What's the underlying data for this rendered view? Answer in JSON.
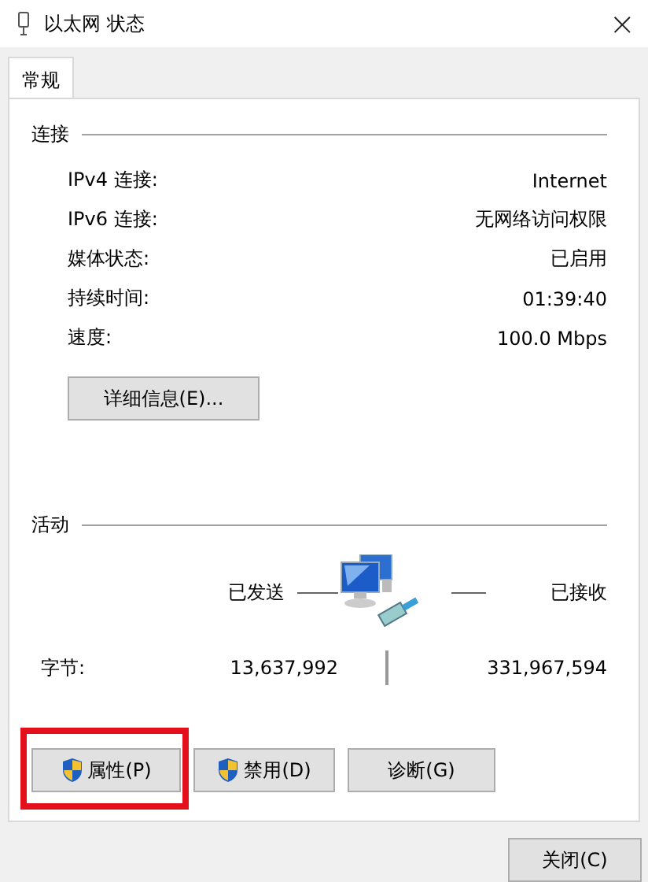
{
  "window": {
    "title": "以太网 状态",
    "close": "×"
  },
  "tabs": [
    {
      "label": "常规",
      "selected": true
    }
  ],
  "connection": {
    "heading": "连接",
    "rows": [
      {
        "label": "IPv4 连接:",
        "value": "Internet"
      },
      {
        "label": "IPv6 连接:",
        "value": "无网络访问权限"
      },
      {
        "label": "媒体状态:",
        "value": "已启用"
      },
      {
        "label": "持续时间:",
        "value": "01:39:40"
      },
      {
        "label": "速度:",
        "value": "100.0 Mbps"
      }
    ],
    "details_button": "详细信息(E)..."
  },
  "activity": {
    "heading": "活动",
    "sent_label": "已发送",
    "received_label": "已接收",
    "bytes_label": "字节:",
    "sent": "13,637,992",
    "received": "331,967,594"
  },
  "buttons": [
    {
      "label": "属性(P)",
      "shield": true,
      "highlighted": true
    },
    {
      "label": "禁用(D)",
      "shield": true,
      "highlighted": false
    },
    {
      "label": "诊断(G)",
      "shield": false,
      "highlighted": false
    }
  ],
  "close_button": "关闭(C)"
}
